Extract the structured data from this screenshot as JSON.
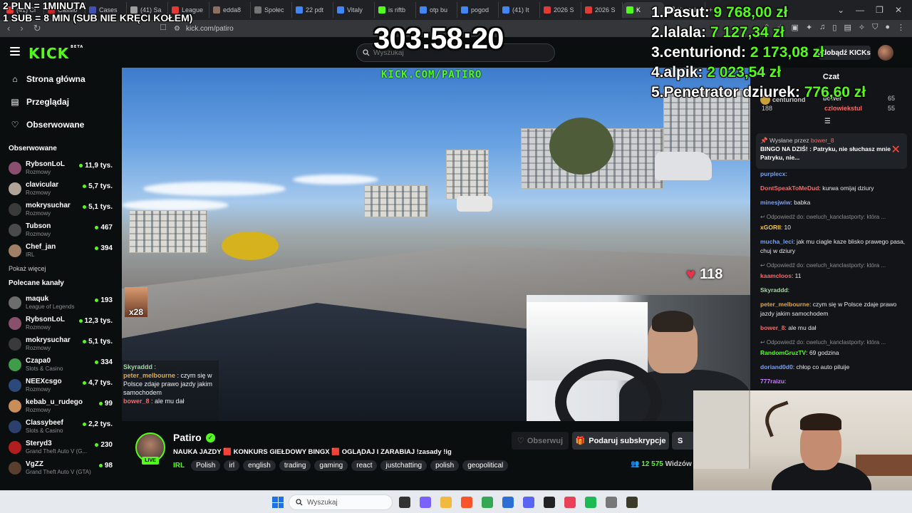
{
  "browser": {
    "tabs": [
      "(41) Cl",
      "Cassio",
      "Cases",
      "(41) Sa",
      "League",
      "edda8",
      "Społec",
      "22 pdt",
      "Vitaly",
      "is riftb",
      "otp bu",
      "pogod",
      "(41) It",
      "2026 S",
      "2026 S",
      "K",
      "Kontak"
    ],
    "new_tab": "+",
    "url": "kick.com/patiro"
  },
  "header": {
    "logo": "KICK",
    "logo_badge": "BETA",
    "search_placeholder": "Wyszukaj",
    "get_kicks": "Zdobądź KICKs"
  },
  "sidebar": {
    "nav": [
      "Strona główna",
      "Przeglądaj",
      "Obserwowane"
    ],
    "followed_heading": "Obserwowane",
    "followed": [
      {
        "name": "RybsonLoL",
        "category": "Rozmowy",
        "viewers": "11,9 tys.",
        "color": "#8a4f6d"
      },
      {
        "name": "clavicular",
        "category": "Rozmowy",
        "viewers": "5,7 tys.",
        "color": "#b0a398"
      },
      {
        "name": "mokrysuchar",
        "category": "Rozmowy",
        "viewers": "5,1 tys.",
        "color": "#3a3a3a"
      },
      {
        "name": "Tubson",
        "category": "Rozmowy",
        "viewers": "467",
        "color": "#4a4a4a"
      },
      {
        "name": "Chef_jan",
        "category": "IRL",
        "viewers": "394",
        "color": "#a07f66"
      }
    ],
    "show_more": "Pokaż więcej",
    "recommended_heading": "Polecane kanały",
    "recommended": [
      {
        "name": "maquk",
        "category": "League of Legends",
        "viewers": "193",
        "color": "#6d6d6d"
      },
      {
        "name": "RybsonLoL",
        "category": "Rozmowy",
        "viewers": "12,3 tys.",
        "color": "#8a4f6d"
      },
      {
        "name": "mokrysuchar",
        "category": "Rozmowy",
        "viewers": "5,1 tys.",
        "color": "#3a3a3a"
      },
      {
        "name": "Czapa0",
        "category": "Slots & Casino",
        "viewers": "334",
        "color": "#3f9d4a"
      },
      {
        "name": "NEEXcsgo",
        "category": "Rozmowy",
        "viewers": "4,7 tys.",
        "color": "#2b4a7a"
      },
      {
        "name": "kebab_u_rudego",
        "category": "Rozmowy",
        "viewers": "99",
        "color": "#c98d5a"
      },
      {
        "name": "Classybeef",
        "category": "Slots & Casino",
        "viewers": "2,2 tys.",
        "color": "#2c3f6e"
      },
      {
        "name": "Steryd3",
        "category": "Grand Theft Auto V (G...",
        "viewers": "230",
        "color": "#b21e1e"
      },
      {
        "name": "VgZZ",
        "category": "Grand Theft Auto V (GTA)",
        "viewers": "98",
        "color": "#5b3f2e"
      }
    ]
  },
  "video": {
    "watermark": "KICK.COM/PATIRO",
    "heart_rate": "118",
    "emote_multiplier": "x28",
    "overlay_chat": [
      {
        "user": "Skyraddd",
        "text": ":",
        "color": "#a4d4a4"
      },
      {
        "user": "peter_melbourne",
        "text": ": czym się w Polsce zdaje prawo jazdy jakim samochodem",
        "color": "#e0a84a"
      },
      {
        "user": "bower_8",
        "text": ": ale mu dał",
        "color": "#f46a6a"
      }
    ]
  },
  "stream": {
    "live": "LIVE",
    "name": "Patiro",
    "title": "NAUKA JAZDY 🟥 KONKURS GIEŁDOWY BINGX 🟥 OGLĄDAJ I ZARABIAJ !zasady !ig",
    "category": "IRL",
    "tags": [
      "Polish",
      "irl",
      "english",
      "trading",
      "gaming",
      "react",
      "justchatting",
      "polish",
      "geopolitical"
    ],
    "follow_label": "Obserwuj",
    "subscribe_label": "Podaruj subskrypcje",
    "more_label": "S",
    "viewers": "12 575",
    "viewers_label": "Widzów"
  },
  "chat": {
    "title": "Czat",
    "gifters": [
      {
        "name": "centuriond",
        "count": "188"
      },
      {
        "name": "bower",
        "count": "65"
      },
      {
        "name": "czlowiekstul",
        "count": "55"
      }
    ],
    "pinned": {
      "by_label": "Wysłane przez",
      "user": "bower_8",
      "text": "BINGO NA DZIŚ! : Patryku, nie słuchasz mnie ❌ Patryku, nie..."
    },
    "messages": [
      {
        "user": "purplecx",
        "text": ":",
        "color": "#7aa0f0"
      },
      {
        "user": "DontSpeakToMeDud",
        "text": ": kurwa omijaj dziury",
        "color": "#f46a6a"
      },
      {
        "user": "minesjwiw",
        "text": ": babka",
        "color": "#7aa0f0"
      },
      {
        "reply": "Odpowiedź do: cweluch_kanclastporty: która ...",
        "user": "xGORII",
        "text": ": 10",
        "color": "#f5c842"
      },
      {
        "user": "mucha_leci",
        "text": ": jak mu ciagle kaze blisko prawego pasa, chuj w dziury",
        "color": "#7aa0f0"
      },
      {
        "reply": "Odpowiedź do: cweluch_kanclastporty: która ...",
        "user": "kaamcloos",
        "text": ": 11",
        "color": "#f46a6a"
      },
      {
        "user": "Skyraddd",
        "text": ":",
        "color": "#a4d4a4"
      },
      {
        "user": "peter_melbourne",
        "text": ": czym się w Polsce zdaje prawo jazdy jakim samochodem",
        "color": "#e0a84a"
      },
      {
        "user": "bower_8",
        "text": ": ale mu dał",
        "color": "#f46a6a"
      },
      {
        "reply": "Odpowiedź do: cweluch_kanclastporty: która ...",
        "user": "RandomGruzTV",
        "text": ": 69 godzina",
        "color": "#53fc18"
      },
      {
        "user": "doriand0d0",
        "text": ": chłop co auto piluije",
        "color": "#7aa0f0"
      },
      {
        "user": "777raizu",
        "text": ":",
        "color": "#c77dff"
      },
      {
        "user": "Skyraddd",
        "text": ":",
        "color": "#a4d4a4"
      }
    ]
  },
  "overlay": {
    "rates": [
      "2 PLN = 1MINUTA",
      "1 SUB = 8 MIN (SUB NIE KRĘCI KOŁEM)"
    ],
    "timer": "303:58:20",
    "leaderboard": [
      {
        "rank": "1.",
        "name": "Pasut:",
        "amount": "9 768,00 zł"
      },
      {
        "rank": "2.",
        "name": "lalala:",
        "amount": "7 127,34 zł"
      },
      {
        "rank": "3.",
        "name": "centuriond:",
        "amount": "2 173,08 zł"
      },
      {
        "rank": "4.",
        "name": "alpik:",
        "amount": "2 023,54 zł"
      },
      {
        "rank": "5.",
        "name": "Penetrator dziurek:",
        "amount": "776,60 zł"
      }
    ]
  },
  "taskbar": {
    "search_placeholder": "Wyszukaj",
    "apps": [
      {
        "name": "file-explorer-icon",
        "color": "#333"
      },
      {
        "name": "copilot-icon",
        "color": "#7b61ff"
      },
      {
        "name": "folder-icon",
        "color": "#f3b93f"
      },
      {
        "name": "brave-icon",
        "color": "#fb542b"
      },
      {
        "name": "chrome-icon",
        "color": "#34a853"
      },
      {
        "name": "store-icon",
        "color": "#2b6fd6"
      },
      {
        "name": "discord-icon",
        "color": "#5865f2"
      },
      {
        "name": "app-icon",
        "color": "#222"
      },
      {
        "name": "app-icon",
        "color": "#e94057"
      },
      {
        "name": "spotify-icon",
        "color": "#1db954"
      },
      {
        "name": "settings-icon",
        "color": "#777"
      },
      {
        "name": "app-icon",
        "color": "#3b3b2a"
      }
    ]
  }
}
